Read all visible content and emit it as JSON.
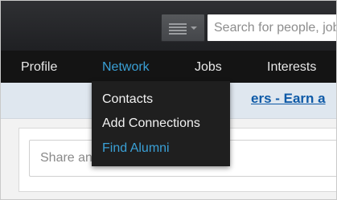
{
  "search": {
    "placeholder": "Search for people, jobs, companies, and more..."
  },
  "icons": {
    "menu": "lines-icon",
    "caret": "chevron-down-icon"
  },
  "nav": {
    "items": [
      "Profile",
      "Network",
      "Jobs",
      "Interests"
    ],
    "active": "Network"
  },
  "dropdown": {
    "items": [
      "Contacts",
      "Add Connections",
      "Find Alumni"
    ],
    "highlighted": "Find Alumni"
  },
  "promo": {
    "link_text": "ers - Earn a"
  },
  "share": {
    "placeholder": "Share an update..."
  },
  "colors": {
    "accent": "#3aa0d6",
    "nav_bg": "#141414",
    "topbar_bg": "#2a2b2e",
    "link": "#0e5aa7"
  }
}
